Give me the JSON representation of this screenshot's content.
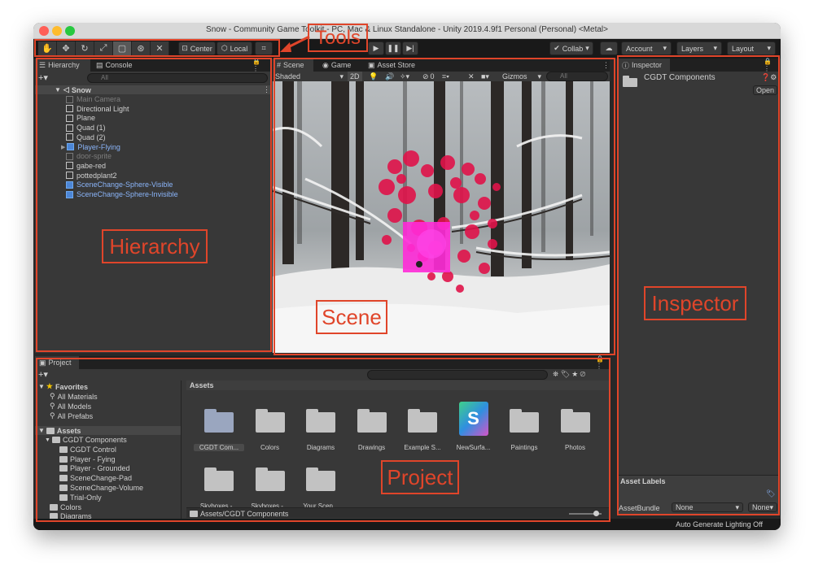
{
  "window": {
    "title": "Snow - Community Game Toolkit - PC, Mac & Linux Standalone - Unity 2019.4.9f1 Personal (Personal) <Metal>"
  },
  "toolbar": {
    "tools": [
      "hand-icon",
      "move-icon",
      "rotate-icon",
      "scale-icon",
      "rect-icon",
      "transform-icon",
      "custom-tool-icon"
    ],
    "center_label": "Center",
    "local_label": "Local",
    "collab_label": "Collab",
    "account_label": "Account",
    "layers_label": "Layers",
    "layout_label": "Layout"
  },
  "hierarchy": {
    "tab_label": "Hierarchy",
    "console_tab": "Console",
    "search_placeholder": "All",
    "scene_name": "Snow",
    "items": [
      {
        "label": "Main Camera",
        "style": "dim"
      },
      {
        "label": "Directional Light",
        "style": "normal"
      },
      {
        "label": "Plane",
        "style": "normal"
      },
      {
        "label": "Quad (1)",
        "style": "normal"
      },
      {
        "label": "Quad (2)",
        "style": "normal"
      },
      {
        "label": "Player-Flying",
        "style": "blue"
      },
      {
        "label": "door-sprite",
        "style": "dim"
      },
      {
        "label": "gabe-red",
        "style": "normal"
      },
      {
        "label": "pottedplant2",
        "style": "normal"
      },
      {
        "label": "SceneChange-Sphere-Visible",
        "style": "blue"
      },
      {
        "label": "SceneChange-Sphere-Invisible",
        "style": "blue"
      }
    ]
  },
  "scene": {
    "tabs": [
      "Scene",
      "Game",
      "Asset Store"
    ],
    "shading_mode": "Shaded",
    "mode_2d": "2D",
    "hidden_count": "0",
    "gizmos_label": "Gizmos",
    "search_placeholder": "All"
  },
  "inspector": {
    "tab_label": "Inspector",
    "asset_name": "CGDT Components",
    "open_button": "Open",
    "asset_labels_header": "Asset Labels",
    "asset_bundle_label": "AssetBundle",
    "asset_bundle_value": "None",
    "asset_bundle_variant": "None"
  },
  "project": {
    "tab_label": "Project",
    "favorites_header": "Favorites",
    "favorites": [
      "All Materials",
      "All Models",
      "All Prefabs"
    ],
    "assets_header": "Assets",
    "tree": [
      "CGDT Components",
      "CGDT Control",
      "Player - Fying",
      "Player - Grounded",
      "SceneChange-Pad",
      "SceneChange-Volume",
      "Trial-Only",
      "Colors",
      "Diagrams"
    ],
    "grid_header": "Assets",
    "grid_items": [
      "CGDT Com...",
      "Colors",
      "Diagrams",
      "Drawings",
      "Example S...",
      "NewSurfa...",
      "Paintings",
      "Photos",
      "Skyboxes -...",
      "Skyboxes -...",
      "Your Scen..."
    ],
    "path": "Assets/CGDT Components"
  },
  "status_bar": {
    "text": "Auto Generate Lighting Off"
  },
  "annotations": {
    "tools": "Tools",
    "hierarchy": "Hierarchy",
    "scene": "Scene",
    "inspector": "Inspector",
    "project": "Project"
  },
  "colors": {
    "annotation": "#e0452a",
    "accent_blue": "#8ab4f8",
    "panel": "#383838",
    "toolbar": "#191919"
  }
}
